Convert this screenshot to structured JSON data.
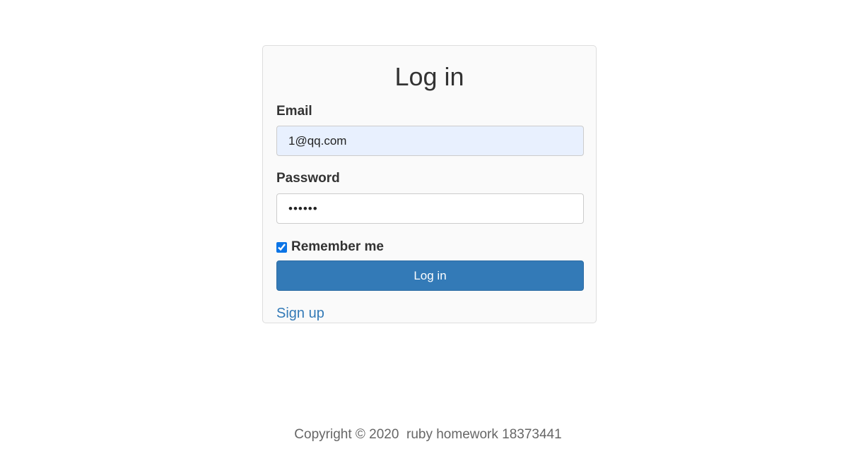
{
  "login": {
    "title": "Log in",
    "email_label": "Email",
    "email_value": "1@qq.com",
    "password_label": "Password",
    "password_value": "••••••",
    "remember_label": "Remember me",
    "remember_checked": true,
    "submit_label": "Log in",
    "signup_label": "Sign up"
  },
  "footer": {
    "copyright": "Copyright © 2020  ruby homework 18373441"
  },
  "colors": {
    "primary": "#337ab7",
    "card_background": "#fafafa",
    "autofill_background": "#e8f0fe"
  }
}
